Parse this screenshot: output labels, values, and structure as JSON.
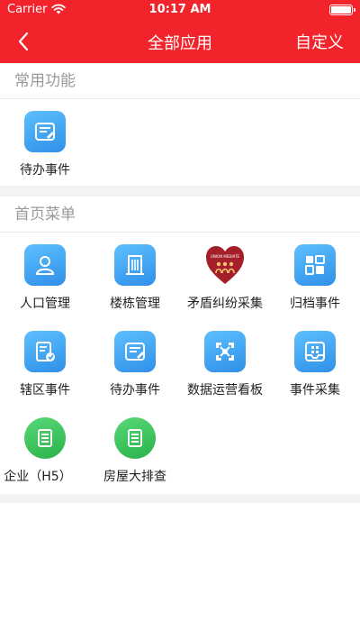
{
  "status_bar": {
    "carrier": "Carrier",
    "time": "10:17 AM"
  },
  "nav": {
    "title": "全部应用",
    "action_label": "自定义"
  },
  "sections": [
    {
      "title": "常用功能",
      "items": [
        {
          "label": "待办事件",
          "icon": "todo-icon"
        }
      ]
    },
    {
      "title": "首页菜单",
      "items": [
        {
          "label": "人口管理",
          "icon": "person-icon"
        },
        {
          "label": "楼栋管理",
          "icon": "building-icon"
        },
        {
          "label": "矛盾纠纷采集",
          "icon": "union-mediate-icon",
          "logo_text": "UNION MEDIATE"
        },
        {
          "label": "归档事件",
          "icon": "archive-grid-icon"
        },
        {
          "label": "辖区事件",
          "icon": "district-doc-icon"
        },
        {
          "label": "待办事件",
          "icon": "todo-icon"
        },
        {
          "label": "数据运营看板",
          "icon": "dashboard-icon"
        },
        {
          "label": "事件采集",
          "icon": "collect-icon"
        },
        {
          "label": "企业（H5）",
          "icon": "enterprise-doc-icon"
        },
        {
          "label": "房屋大排查",
          "icon": "house-check-doc-icon"
        }
      ]
    }
  ],
  "colors": {
    "header_bg": "#f2232a",
    "icon_blue": "#3a9cf0",
    "icon_green": "#36c25a",
    "logo_maroon": "#a51f2b"
  }
}
